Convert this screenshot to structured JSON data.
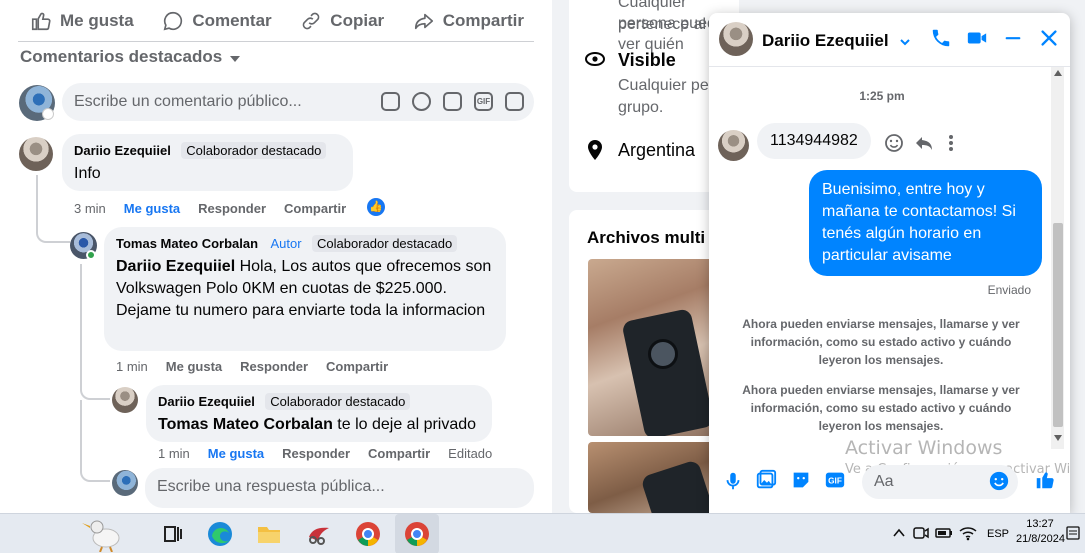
{
  "post_actions": {
    "like": "Me gusta",
    "comment": "Comentar",
    "copy": "Copiar",
    "share": "Compartir"
  },
  "comments_section": {
    "sort_label": "Comentarios destacados",
    "input_placeholder": "Escribe un comentario público...",
    "reply_placeholder": "Escribe una respuesta pública...",
    "input_icons": [
      "sticker-icon",
      "emoji-icon",
      "camera-icon",
      "gif-icon",
      "avatar-sticker-icon"
    ]
  },
  "comments": [
    {
      "author": "Dariio Ezequiiel",
      "badge": "Colaborador destacado",
      "text": "Info",
      "time": "3 min",
      "like": "Me gusta",
      "reply": "Responder",
      "share": "Compartir"
    },
    {
      "author": "Tomas Mateo Corbalan",
      "author_label": "Autor",
      "badge": "Colaborador destacado",
      "mention": "Dariio Ezequiiel",
      "text": "Hola, Los autos que ofrecemos son Volkswagen Polo 0KM en cuotas de $225.000. Dejame tu numero para enviarte toda la informacion",
      "time": "1 min",
      "like": "Me gusta",
      "reply": "Responder",
      "share": "Compartir"
    },
    {
      "author": "Dariio Ezequiiel",
      "badge": "Colaborador destacado",
      "mention": "Tomas Mateo Corbalan",
      "text": "te lo deje al privado",
      "time": "1 min",
      "like": "Me gusta",
      "reply": "Responder",
      "share": "Compartir",
      "edited": "Editado"
    }
  ],
  "right_panel": {
    "privacy_fragment_1": "Cualquier persona puede ver quién",
    "privacy_fragment_2": "pertenece al",
    "visible_title": "Visible",
    "visible_text_1": "Cualquier pe",
    "visible_text_2": "grupo.",
    "location": "Argentina",
    "media_title": "Archivos multi"
  },
  "messenger": {
    "contact_name": "Dariio Ezequiiel",
    "time": "1:25 pm",
    "incoming_message": "1134944982",
    "outgoing_message": "Buenisimo, entre hoy y mañana te contactamos! Si tenés algún horario en particular avisame",
    "status": "Enviado",
    "system_message_lines": [
      "Ahora pueden enviarse mensajes, llamarse y ver",
      "información, como su estado activo y cuándo",
      "leyeron los mensajes."
    ],
    "composer_placeholder": "Aa",
    "accent_color": "#0084ff"
  },
  "watermark": {
    "title": "Activar Windows",
    "subtitle": "Ve a Configuración para activar Windows."
  },
  "taskbar": {
    "language": "ESP",
    "time": "13:27",
    "date": "21/8/2024"
  }
}
